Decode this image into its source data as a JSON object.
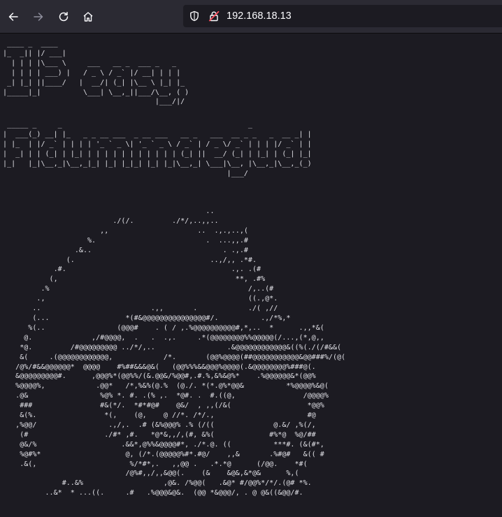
{
  "browser": {
    "back_icon": "arrow-left-icon",
    "forward_icon": "arrow-right-icon",
    "reload_icon": "reload-icon",
    "home_icon": "home-icon",
    "shield_icon": "shield-icon",
    "lock_icon": "insecure-lock-icon",
    "url": "192.168.18.13"
  },
  "page": {
    "banner_title": " ____ _  ____\n|_  _|| |/ ___|\n  | | | |\\___ \\     ___   __ _  ___ _   _\n  | | | | ___) |   / _ \\ / _` |/ __| | | |\n _| |_| ||____/   |  __/| (_| |\\__ \\ |_| |_\n|_____|_|          \\___| \\__,_||___/\\__, ( )\n                                    |___/|/",
    "banner_subtitle": " _____ _     _                                            _\n|  ___(_) __| |_   _ _ __ ___  _ __ ___   __ _   ___  __ _ _   _  __ _| |\n| |_  | |/ _` | | | | '_ ` _ \\| '_ ` _ \\ / _` | / _ \\/ _` | | | |/ _` | |\n|  _| | | (_| | |_| | | | | | | | | | | | (_| ||  __/ (_| | |_| | (_| |_|\n|_|   |_|\\__,_|\\__,_|_| |_| |_|_| |_| |_|\\__,_| \\___|\\__, |\\__,_|\\__,_(_)\n                                                     |___/",
    "ascii_art": "                                                ..\n                          ./(/.         ./*/,..,,..\n                       ,,                     ..  .,.,..,(\n                    %.                          .  ...,,.#\n                 .&..                               . .,.#\n               (.                                ..,/,, .*#.\n            .#.                                       .,. .(#\n           (,                                          **, .#%\n         .%                                               /,..(#\n        .,                                                ((.,@*.\n       ..                          .,,       .            ./( ,//\n       (...                  *(#&@@@@@@@@@@@@@@@#/.          .,/*%,*\n      %(..                 (@@@#    . ( / ,.%@@@@@@@@@@#,*,..  *      .,,*&(\n     @.              ,/#@@@@,  .   .  .,.     .*(@@@@@@@@%%@@@@@(/...,(*,@,,\n    *@.         /#@@@@@@@@@ ../*/,..                 .&@@@@@@@@@@@@&((%(./(/#&&(\n    &(     .(@@@@@@@@@@@@,            /*.       (@@%@@@@(##@@@@@@@@@@@&@@###%/(@(\n   /@%/#&&@@@@@@*  @@@@    #%##&&&@&(   (@@%%%&&@@@%@@@@(.&@@@@@@@@%###@(.\n   &@@@@@@@@@#.      ,@@@%*(@@%%/(&.@@&/%@@#,.#.%,&%&@%*    .%@@@@@@&*(@@%\n   %@@@@%,            .@@*   /*,%&%(@.%  (@./. *(*.@%*@@&          *%@@@@%&@(\n   .@&                 %@% *. #. .(% ,.  *@#. .  #.((@,                /@@@@%\n    ###                #&(*/.  *#*#@#    @&/  , ,,(/&(                  *@@%\n    &(%.                *(,    (@,    @ //*. /*/.,                      #@\n   ,%@@/                 .,/,.  .# (&%@@@% .% (/((              @.&/ ,%(/,\n    (#                  ./#* ,#.   *@*&,,/,(#, &%(             #%*@  %@/##\n    @&/%                    .&&*,@%%&@@@@#*, ./*.@. ((          ***#. (&(#*,\n    %@#%*                    @, (/*.(@@@@@%#*.#@/    ,,&       .%#@#   &(( #\n    .&(,                      %/*#*,.   ,,@@ .   .*.*@      (/@@.    *#(\n                             /@%#,,/,,&@@(.    (&    &@&,&*@&      %,(\n              #..&%                   ,@&. /%@@(   .&@* #/@@%*/*/.(@# *%.\n          ..&*  * ...((.     .#   .%@@@&@&.  (@@ *&@@@/, . @ @&((&@@/#."
  }
}
